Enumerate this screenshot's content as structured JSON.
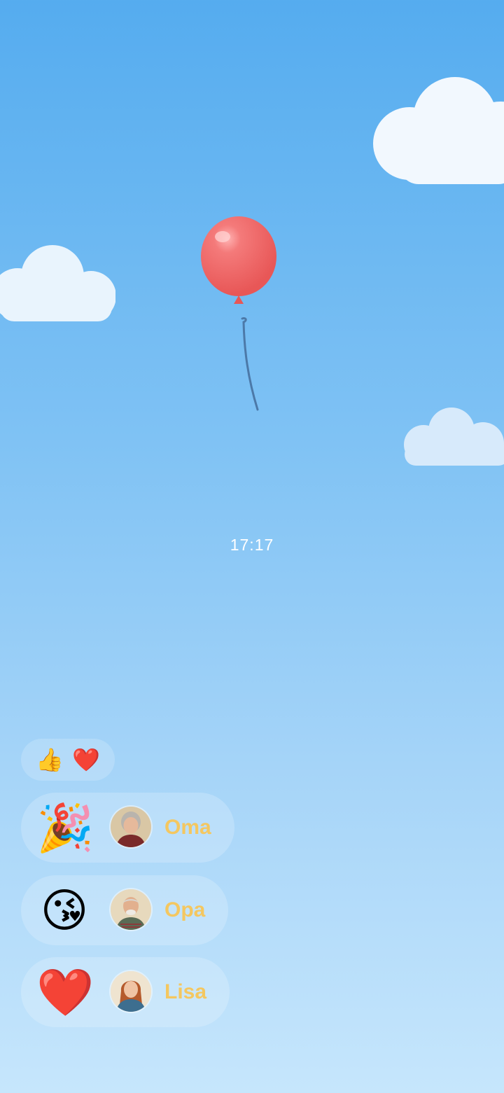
{
  "clock": {
    "time": "17:17"
  },
  "reactions": {
    "summary_emojis": [
      "👍",
      "❤️"
    ]
  },
  "rows": [
    {
      "emoji": "🎉",
      "emoji_name": "party-popper-icon",
      "name": "Oma",
      "avatar": "grandmother-avatar"
    },
    {
      "emoji": "😘",
      "emoji_name": "kiss-face-icon",
      "name": "Opa",
      "avatar": "grandfather-avatar"
    },
    {
      "emoji": "❤️",
      "emoji_name": "red-heart-icon",
      "name": "Lisa",
      "avatar": "young-woman-avatar"
    }
  ],
  "colors": {
    "sky_top": "#55acef",
    "sky_bottom": "#c6e6fc",
    "balloon": "#f26b6b",
    "name_text": "#f4c760"
  }
}
